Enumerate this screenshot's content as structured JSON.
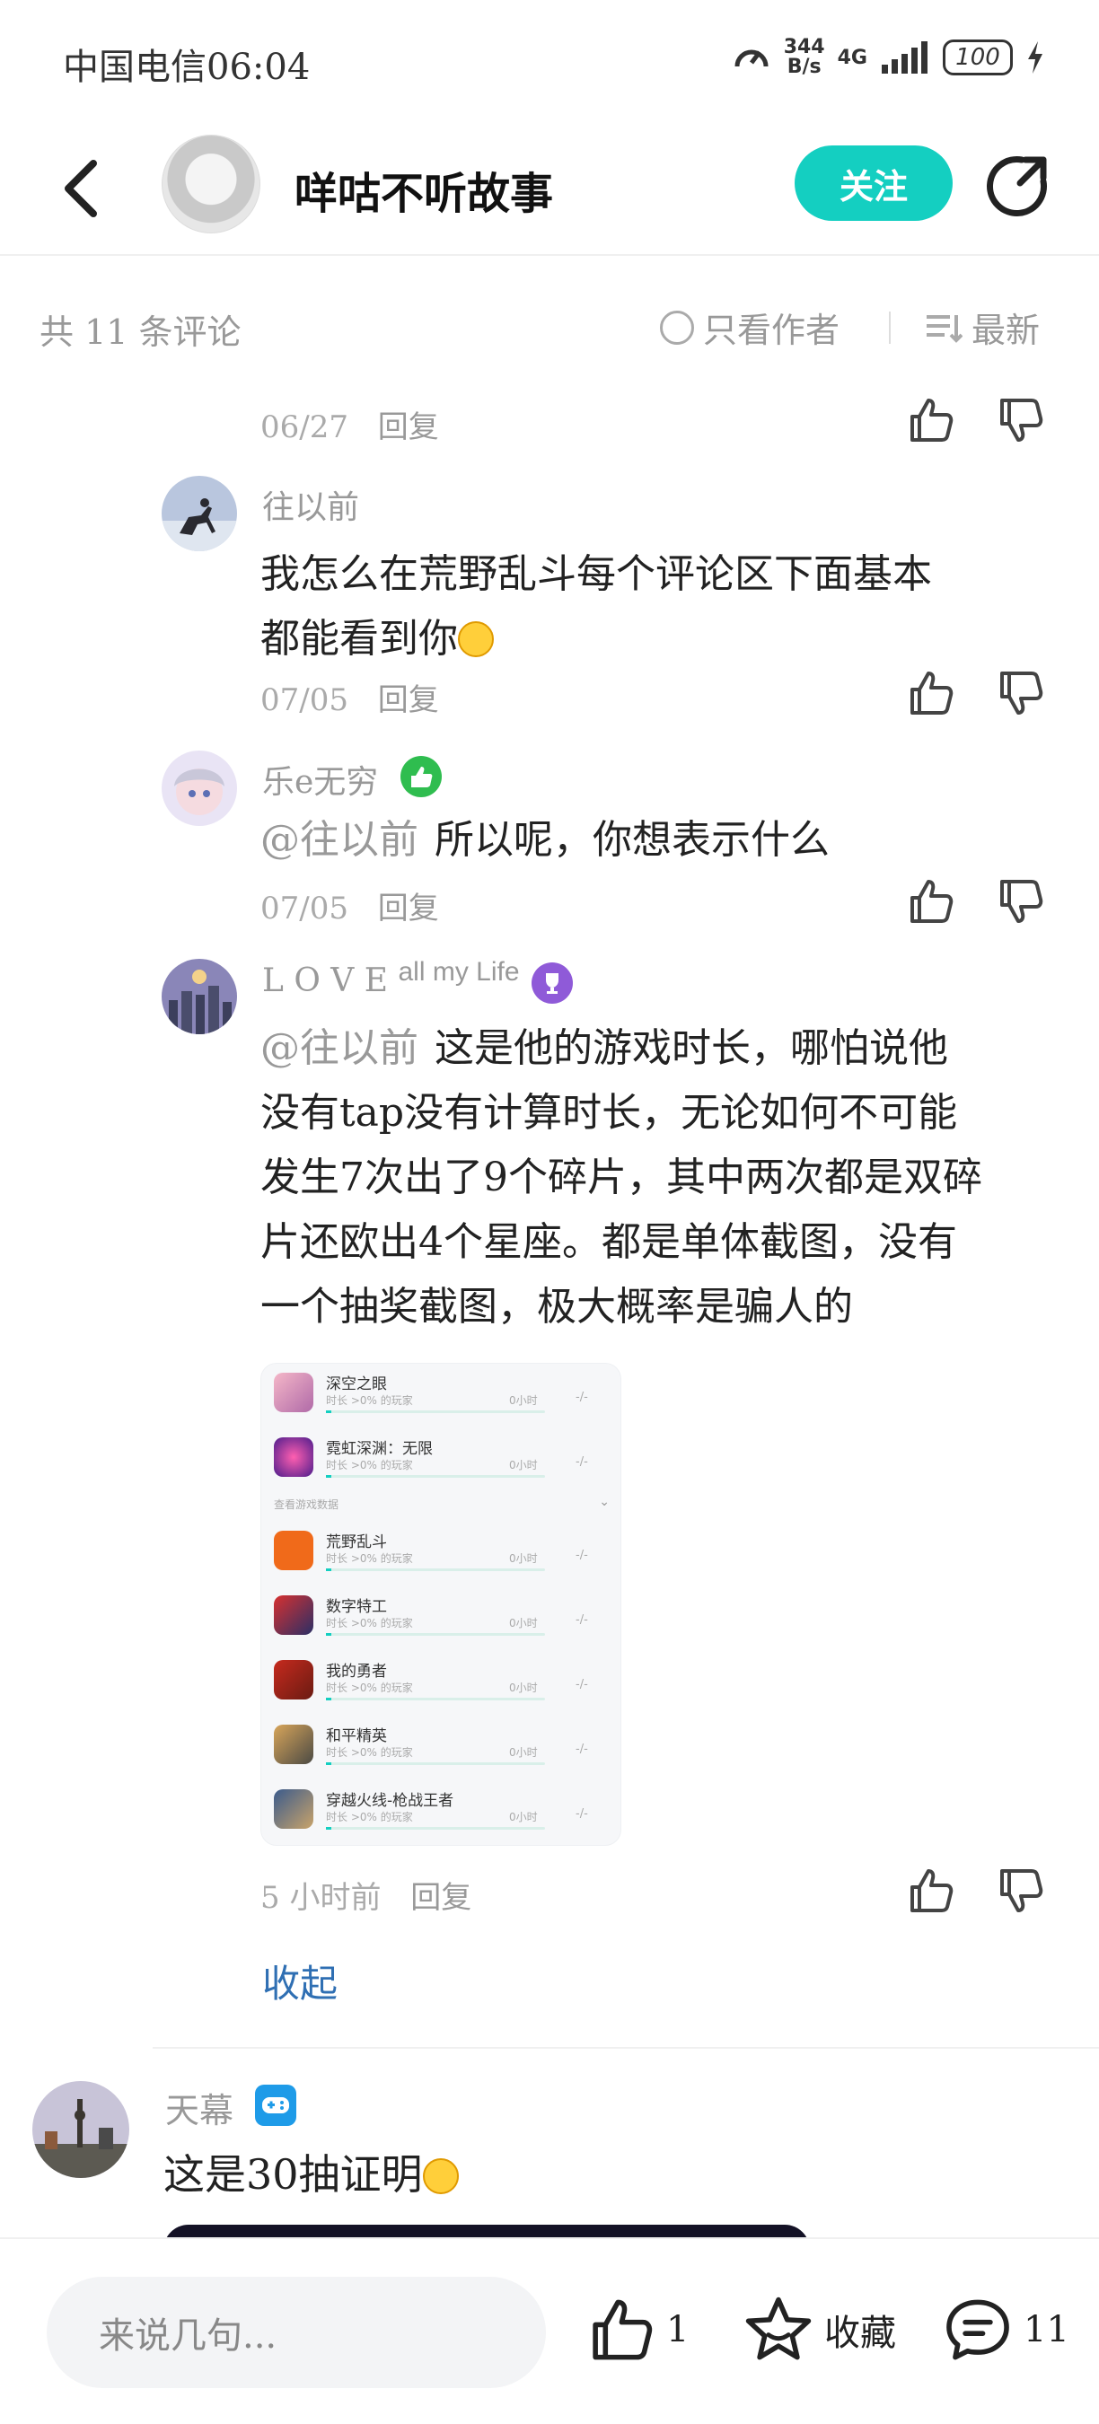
{
  "status_bar": {
    "carrier_time": "中国电信06:04",
    "net_speed_value": "344",
    "net_speed_unit": "B/s",
    "network": "4G",
    "battery": "100"
  },
  "header": {
    "author_name": "咩咕不听故事",
    "follow_label": "关注"
  },
  "comment_bar": {
    "count_text": "共 11 条评论",
    "author_only_label": "只看作者",
    "sort_label": "最新"
  },
  "replies": [
    {
      "date": "06/27",
      "reply_label": "回复"
    },
    {
      "name": "往以前",
      "text_line1": "我怎么在荒野乱斗每个评论区下面基本",
      "text_line2": "都能看到你",
      "date": "07/05",
      "reply_label": "回复"
    },
    {
      "name": "乐e无穷",
      "mention": "@往以前",
      "text": "所以呢，你想表示什么",
      "date": "07/05",
      "reply_label": "回复"
    },
    {
      "name_part1": "L O V E",
      "name_part2": "all my Life",
      "mention": "@往以前",
      "text_line1": "这是他的游戏时长，哪怕说他",
      "text_line2": "没有tap没有计算时长，无论如何不可能",
      "text_line3": "发生7次出了9个碎片，其中两次都是双碎",
      "text_line4": "片还欧出4个星座。都是单体截图，没有",
      "text_line5": "一个抽奖截图，极大概率是骗人的",
      "date": "5 小时前",
      "reply_label": "回复"
    }
  ],
  "screenshot": {
    "section_label": "查看游戏数据",
    "sub_label": "时长 >0% 的玩家",
    "hours": "0小时",
    "dash": "-/-",
    "games": [
      "深空之眼",
      "霓虹深渊：无限",
      "荒野乱斗",
      "数字特工",
      "我的勇者",
      "和平精英",
      "穿越火线-枪战王者"
    ]
  },
  "collapse_label": "收起",
  "main_comment": {
    "name": "天幕",
    "text": "这是30抽证明"
  },
  "bottom_bar": {
    "input_placeholder": "来说几句...",
    "like_count": "1",
    "favorite_label": "收藏",
    "comment_count": "11"
  },
  "colors": {
    "accent": "#14cfc1",
    "link": "#2f6fb3",
    "muted": "#999999"
  }
}
